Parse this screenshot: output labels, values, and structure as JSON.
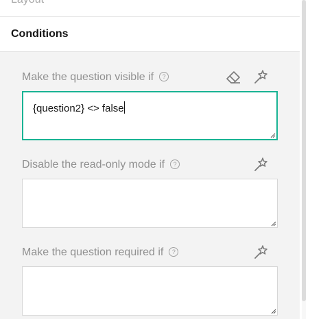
{
  "sections": {
    "layout_title": "Layout",
    "conditions_title": "Conditions"
  },
  "conditions": [
    {
      "label": "Make the question visible if",
      "help_glyph": "?",
      "value": "{question2} <> false",
      "placeholder": "",
      "icons": [
        "eraser-icon",
        "magic-wand-icon"
      ],
      "focused": true
    },
    {
      "label": "Disable the read-only mode if",
      "help_glyph": "?",
      "value": "",
      "placeholder": "",
      "icons": [
        "magic-wand-icon"
      ],
      "focused": false
    },
    {
      "label": "Make the question required if",
      "help_glyph": "?",
      "value": "",
      "placeholder": "",
      "icons": [
        "magic-wand-icon"
      ],
      "focused": false
    }
  ],
  "colors": {
    "accent": "#19b394",
    "panel_bg": "#f3f3f3",
    "label": "#909090",
    "text": "#161616"
  }
}
